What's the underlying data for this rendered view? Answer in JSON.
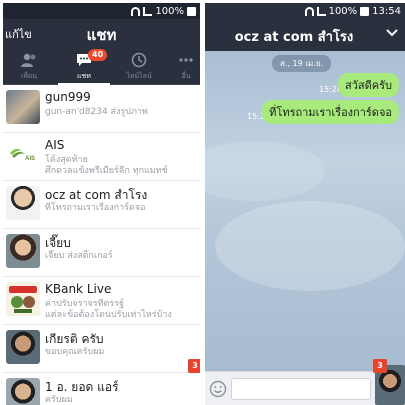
{
  "left": {
    "status": {
      "battery": "100%"
    },
    "header": {
      "edit_label": "แก้ไข",
      "title": "แชท"
    },
    "tabs": [
      {
        "label": "เพื่อน",
        "icon": "friends-icon"
      },
      {
        "label": "แชท",
        "icon": "chat-icon",
        "badge": "40"
      },
      {
        "label": "ไทม์ไลน์",
        "icon": "timeline-icon"
      },
      {
        "label": "อื่น",
        "icon": "more-icon"
      }
    ],
    "chats": [
      {
        "name": "gun999",
        "msg1": "gun-an'd8234 ส่งรูปภาพ",
        "msg2": ""
      },
      {
        "name": "AIS",
        "msg1": "โค้งสุดท้าย",
        "msg2": "ศึกดวลแข้งพรีเมียร์ลีก ทุกแมทช์"
      },
      {
        "name": "ocz at com สำโรง",
        "msg1": "ที่โทรถามเราเรื่องการ์ดจอ",
        "msg2": ""
      },
      {
        "name": "เจี๊ยบ",
        "msg1": "เจี๊ยบ ส่งสติ๊กเกอร์",
        "msg2": ""
      },
      {
        "name": "KBank Live",
        "msg1": "ค่าปรับจราจรที่ตรรฐ์",
        "msg2": "แต่ละข้อต้องโดนปรับเท่าไหร่บ้าง"
      },
      {
        "name": "เกียรติ ครับ",
        "msg1": "ขอบคุณครับผม",
        "msg2": ""
      },
      {
        "name": "1 อ. ยอด แอร์",
        "msg1": "ครับผม",
        "msg2": ""
      }
    ],
    "float_badge": "3"
  },
  "right": {
    "status": {
      "battery": "100%",
      "time": "13:54"
    },
    "header": {
      "title": "ocz at com สำโรง"
    },
    "date_label": "ส., 19 เม.ย.",
    "messages": [
      {
        "text": "สวัสดีครับ",
        "time": "15:20"
      },
      {
        "text": "ที่โทรถามเราเรื่องการ์ดจอ",
        "time": "15:20"
      }
    ],
    "input": {
      "placeholder": ""
    },
    "float_badge": "3"
  },
  "colors": {
    "header_bg": "#2a303e",
    "badge": "#f04a2e",
    "bubble": "#a8ea7c",
    "chat_bg": "#b3c5d8"
  }
}
